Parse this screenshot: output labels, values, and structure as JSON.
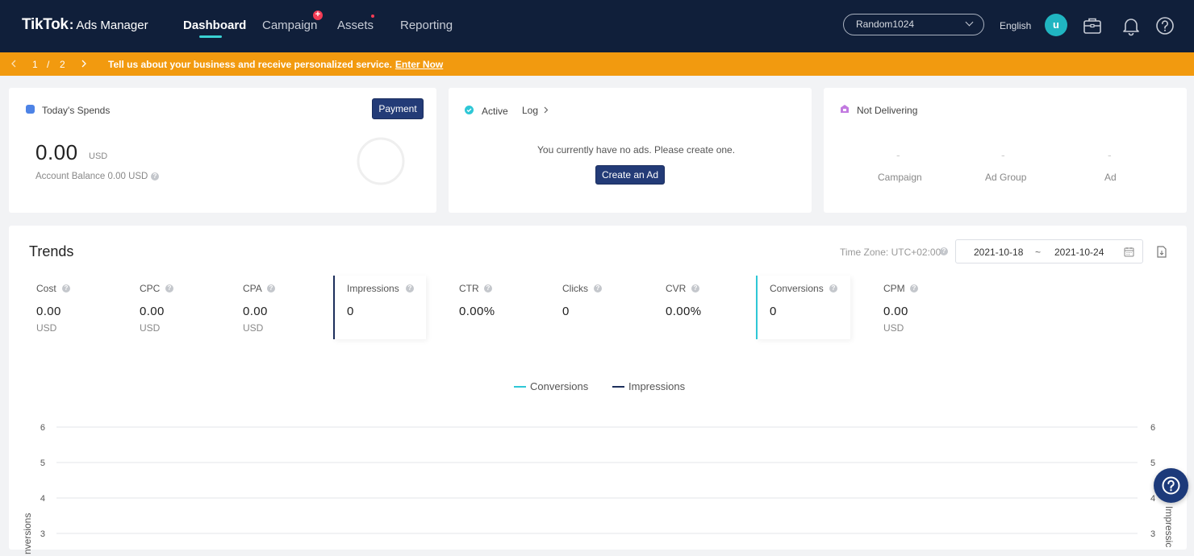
{
  "header": {
    "logo_brand": "TikTok",
    "logo_colon": ":",
    "logo_product": "Ads Manager",
    "tabs": [
      {
        "label": "Dashboard",
        "active": true
      },
      {
        "label": "Campaign",
        "badge": "+"
      },
      {
        "label": "Assets"
      },
      {
        "label": "Reporting"
      }
    ],
    "account_name": "Random1024",
    "language": "English",
    "avatar_initial": "u",
    "icons": [
      "briefcase-icon",
      "bell-icon",
      "help-circle-icon"
    ]
  },
  "banner": {
    "current_page": "1",
    "separator": "/",
    "total_pages": "2",
    "message": "Tell us about your business and receive personalized service.",
    "link": "Enter Now",
    "color": "#f29a0f"
  },
  "spends_card": {
    "title": "Today's Spends",
    "button": "Payment",
    "amount": "0.00",
    "currency": "USD",
    "balance": "Account Balance 0.00 USD"
  },
  "active_card": {
    "title": "Active",
    "log": "Log",
    "message": "You currently have no ads. Please create one.",
    "button": "Create an Ad"
  },
  "not_delivering_card": {
    "title": "Not Delivering",
    "columns": [
      {
        "label": "Campaign",
        "value": "-"
      },
      {
        "label": "Ad Group",
        "value": "-"
      },
      {
        "label": "Ad",
        "value": "-"
      }
    ]
  },
  "trends": {
    "title": "Trends",
    "timezone": "Time Zone: UTC+02:00",
    "date_start": "2021-10-18",
    "date_sep": "~",
    "date_end": "2021-10-24",
    "metrics": [
      {
        "label": "Cost",
        "value": "0.00",
        "unit": "USD"
      },
      {
        "label": "CPC",
        "value": "0.00",
        "unit": "USD"
      },
      {
        "label": "CPA",
        "value": "0.00",
        "unit": "USD"
      },
      {
        "label": "Impressions",
        "value": "0",
        "unit": "",
        "selected": true
      },
      {
        "label": "CTR",
        "value": "0.00%",
        "unit": ""
      },
      {
        "label": "Clicks",
        "value": "0",
        "unit": ""
      },
      {
        "label": "CVR",
        "value": "0.00%",
        "unit": ""
      },
      {
        "label": "Conversions",
        "value": "0",
        "unit": "",
        "selected": true
      },
      {
        "label": "CPM",
        "value": "0.00",
        "unit": "USD"
      }
    ]
  },
  "chart_data": {
    "type": "line",
    "series": [
      {
        "name": "Conversions",
        "color": "#2ec7d6",
        "values": []
      },
      {
        "name": "Impressions",
        "color": "#1d2f5c",
        "values": []
      }
    ],
    "yticks_left": [
      6,
      5,
      4,
      3
    ],
    "yticks_right": [
      6,
      5,
      4,
      3
    ],
    "ylabel_left": "nversions",
    "ylabel_right": "Impressic",
    "grid": true,
    "legend": "top-center"
  }
}
